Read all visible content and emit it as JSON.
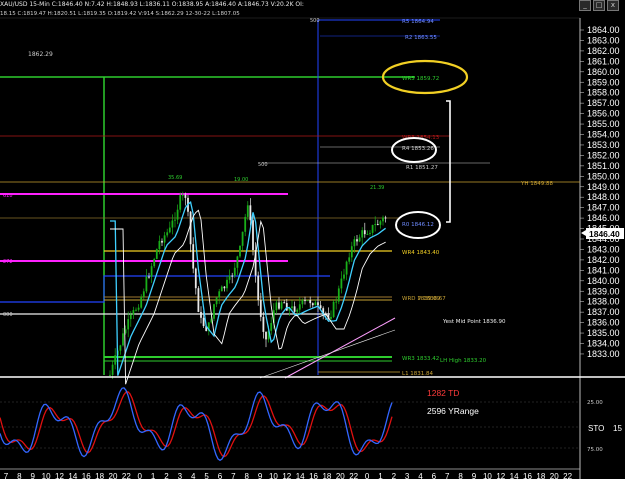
{
  "header": {
    "symbol_line": "XAU/USD  15-Min  C:1846.40  N:7.42  H:1848.93  L:1836.11  O:1838.95  A:1846.40  A:1846.73  V:20.2K  OI:",
    "studies_line": "18.15  C:1819.47  H:1820.51  L:1819.35  O:1819.42  V:914  S:1862.29  12-30-22  L:1807.05",
    "window_buttons": [
      "_",
      "□",
      "x"
    ]
  },
  "price_axis": {
    "labels": [
      "1864.00",
      "1863.00",
      "1862.00",
      "1861.00",
      "1860.00",
      "1859.00",
      "1858.00",
      "1857.00",
      "1856.00",
      "1855.00",
      "1854.00",
      "1853.00",
      "1852.00",
      "1851.00",
      "1850.00",
      "1849.00",
      "1848.00",
      "1847.00",
      "1846.00",
      "1845.00",
      "1844.00",
      "1843.00",
      "1842.00",
      "1841.00",
      "1840.00",
      "1839.00",
      "1838.00",
      "1837.00",
      "1836.00",
      "1835.00",
      "1834.00",
      "1833.00"
    ],
    "current_price": "1846.40"
  },
  "time_axis": {
    "labels": [
      "7",
      "8",
      "9",
      "10",
      "12",
      "14",
      "16",
      "18",
      "20",
      "22",
      "0",
      "1",
      "2",
      "3",
      "4",
      "5",
      "6",
      "7",
      "8",
      "9",
      "10",
      "12",
      "14",
      "16",
      "18",
      "20",
      "22",
      "0",
      "1",
      "2",
      "3",
      "4",
      "6",
      "7",
      "8",
      "9",
      "10",
      "12",
      "14",
      "16",
      "18",
      "20",
      "22"
    ]
  },
  "levels": {
    "r5": "R5 1864.94",
    "r2": "R2 1863.55",
    "wr5": "WR5 1859.72",
    "wr_red": "WR3 1854.13",
    "r4": "R4 1853.26",
    "r1": "R1 1851.27",
    "yh": "YH 1849.88",
    "r0": "R0 1846.12",
    "wr4": "WR4 1843.40",
    "wrd": "WRD 1839.09",
    "pivot": "P 1838.67",
    "yest_mid": "Yest Mid Point 1836.90",
    "wr3": "WR3 1833.42",
    "lh_high": "LH High 1833.20",
    "l1": "L1 1831.84",
    "label_1862": "1862.29",
    "label_500_top": "500",
    "label_500_mid": "500",
    "label_618": "618",
    "label_272": "272",
    "label_000": "000",
    "peak_a": "35.69",
    "peak_b": "19.00",
    "peak_c": "21.39"
  },
  "oscillator": {
    "td_text": "1282 TD",
    "yrange_text": "2596 YRange",
    "name": "STO",
    "period": "15",
    "level_high": "25.00",
    "level_low": "75.00"
  },
  "colors": {
    "background": "#000000",
    "green_box": "#2ecc2e",
    "magenta": "#ff22ff",
    "blue": "#2244ff",
    "yellow": "#f2d024",
    "candle_up": "#19b019",
    "candle_down": "#e8e8e8",
    "ma_cyan": "#3fd0ff",
    "osc_red": "#e01010",
    "osc_blue": "#3366ff"
  },
  "icons": {
    "price_marker": "arrow-left-icon"
  }
}
